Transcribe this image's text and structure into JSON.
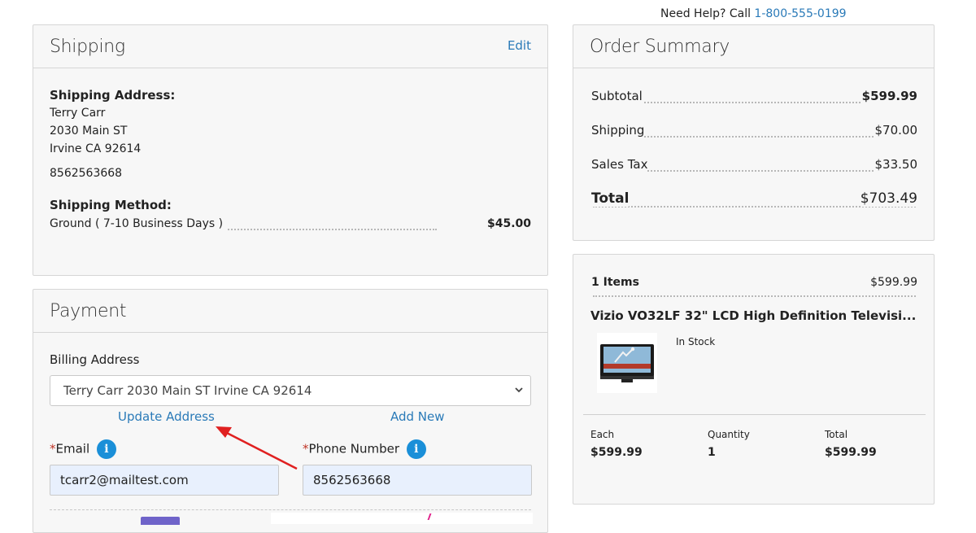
{
  "help": {
    "prefix": "Need Help? Call ",
    "phone": "1-800-555-0199"
  },
  "shipping": {
    "title": "Shipping",
    "edit_label": "Edit",
    "address_heading": "Shipping Address:",
    "name": "Terry Carr",
    "street": "2030 Main ST",
    "city_line": "Irvine CA 92614",
    "phone": "8562563668",
    "method_heading": "Shipping Method:",
    "method_name": "Ground ( 7-10 Business Days )",
    "method_price": "$45.00"
  },
  "payment": {
    "title": "Payment",
    "billing_label": "Billing Address",
    "billing_selected": "Terry Carr 2030 Main ST Irvine CA 92614",
    "update_address_label": "Update Address",
    "add_new_label": "Add New",
    "email_label": "Email",
    "email_value": "tcarr2@mailtest.com",
    "phone_label": "Phone Number",
    "phone_value": "8562563668",
    "required_mark": "*",
    "info_glyph": "i"
  },
  "order_summary": {
    "title": "Order Summary",
    "rows": [
      {
        "label": "Subtotal",
        "value": "$599.99"
      },
      {
        "label": "Shipping",
        "value": "$70.00"
      },
      {
        "label": "Sales Tax",
        "value": "$33.50"
      },
      {
        "label": "Total",
        "value": "$703.49"
      }
    ]
  },
  "cart": {
    "items_label": "1 Items",
    "items_total": "$599.99",
    "product_name": "Vizio VO32LF 32\" LCD High Definition Televisi...",
    "stock_status": "In Stock",
    "each_label": "Each",
    "each_value": "$599.99",
    "quantity_label": "Quantity",
    "quantity_value": "1",
    "total_label": "Total",
    "total_value": "$599.99"
  },
  "colors": {
    "link": "#2a7ab8",
    "info": "#1a8fd8",
    "annotation_arrow": "#e02020",
    "field_bg": "#e8f0fd"
  },
  "icons": {
    "info": "info-icon",
    "dropdown": "chevron-down-icon",
    "arrow": "annotation-arrow"
  }
}
